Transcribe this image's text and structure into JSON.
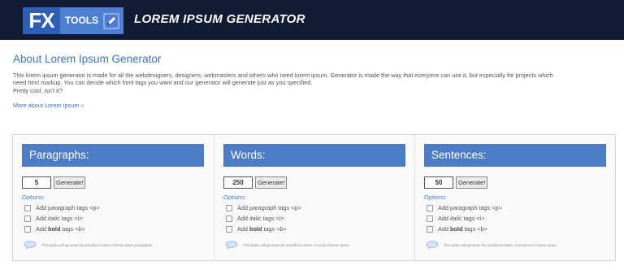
{
  "header": {
    "logo_fx": "FX",
    "logo_tools": "TOOLS",
    "title": "LOREM IPSUM GENERATOR"
  },
  "about": {
    "title": "About Lorem Ipsum Generator",
    "line1": "This lorem ipsum generator is made for all the webdesigners, designers, webmasters and others who need lorem ipsum. Generator is made the way that everyone can use it, but especially for projects which",
    "line2": "need html markup. You can decide which html tags you want and our generator will generate just as you specified.",
    "line3": "Pretty cool, isn't it?",
    "more_link": "More about Lorem Ipsum »"
  },
  "generators": [
    {
      "title": "Paragraphs:",
      "count": "5",
      "button": "Generate!",
      "options_label": "Options:",
      "opt_para": {
        "pre": "Add paragraph tags ",
        "tag": "<p>"
      },
      "opt_italic": {
        "pre": "Add ",
        "word": "italic",
        "post": " tags ",
        "tag": "<i>"
      },
      "opt_bold": {
        "pre": "Add ",
        "word": "bold",
        "post": " tags ",
        "tag": "<b>"
      },
      "hint": "This option will generate the specified number of lorem ipsum paragraphs."
    },
    {
      "title": "Words:",
      "count": "250",
      "button": "Generate!",
      "options_label": "Options:",
      "opt_para": {
        "pre": "Add paragraph tags ",
        "tag": "<p>"
      },
      "opt_italic": {
        "pre": "Add ",
        "word": "italic",
        "post": " tags ",
        "tag": "<i>"
      },
      "opt_bold": {
        "pre": "Add ",
        "word": "bold",
        "post": " tags ",
        "tag": "<b>"
      },
      "hint": "This option will generate the specified number of words of lorem ipsum."
    },
    {
      "title": "Sentences:",
      "count": "50",
      "button": "Generate!",
      "options_label": "Options:",
      "opt_para": {
        "pre": "Add paragraph tags ",
        "tag": "<p>"
      },
      "opt_italic": {
        "pre": "Add ",
        "word": "italic",
        "post": " tags ",
        "tag": "<i>"
      },
      "opt_bold": {
        "pre": "Add ",
        "word": "bold",
        "post": " tags ",
        "tag": "<b>"
      },
      "hint": "This option will generate the specified number of sentences of lorem ipsum."
    }
  ],
  "icons": {
    "logo_pencil": "pencil-icon",
    "hint_bubble": "speech-bubble-icon"
  },
  "colors": {
    "header_bg": "#0f1a33",
    "accent": "#4d7cc7",
    "link": "#3a74c4"
  }
}
